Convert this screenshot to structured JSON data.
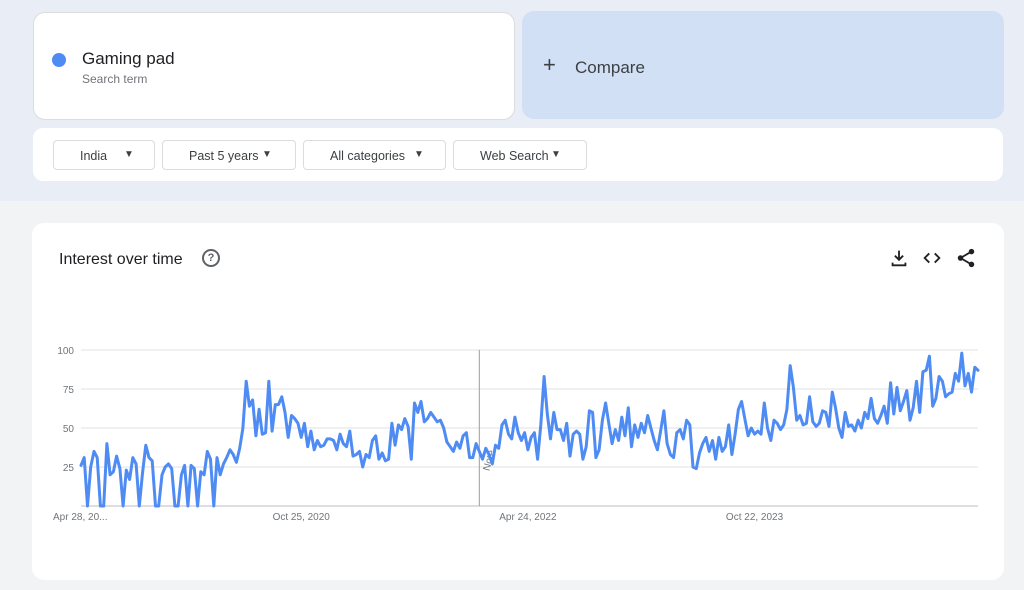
{
  "search_term": {
    "name": "Gaming pad",
    "subtitle": "Search term",
    "color": "#4e8cf4"
  },
  "compare": {
    "plus": "+",
    "label": "Compare"
  },
  "filters": {
    "region": "India",
    "time_range": "Past 5 years",
    "category": "All categories",
    "search_type": "Web Search"
  },
  "chart_section": {
    "title": "Interest over time",
    "help_icon": "help-circle-icon",
    "tools": [
      "download-icon",
      "embed-code-icon",
      "share-icon"
    ]
  },
  "chart_data": {
    "type": "line",
    "y_ticks": [
      25,
      50,
      75,
      100
    ],
    "ylim": [
      0,
      100
    ],
    "x_labels": [
      "Apr 28, 20...",
      "Oct 25, 2020",
      "Apr 24, 2022",
      "Oct 22, 2023"
    ],
    "grid": true,
    "annotation_week_index": 123,
    "annotation_label": "Note",
    "series": [
      {
        "color": "#4e8cf4",
        "values": [
          26,
          31,
          0,
          25,
          35,
          31,
          0,
          0,
          40,
          20,
          22,
          32,
          24,
          0,
          23,
          17,
          31,
          27,
          0,
          21,
          39,
          31,
          29,
          0,
          0,
          20,
          25,
          27,
          24,
          0,
          0,
          20,
          26,
          0,
          26,
          24,
          0,
          22,
          20,
          35,
          30,
          0,
          31,
          20,
          27,
          31,
          36,
          33,
          28,
          37,
          50,
          80,
          64,
          68,
          45,
          62,
          46,
          47,
          80,
          48,
          65,
          65,
          70,
          60,
          44,
          58,
          56,
          53,
          44,
          53,
          38,
          48,
          36,
          42,
          38,
          39,
          43,
          43,
          42,
          36,
          46,
          40,
          38,
          48,
          32,
          33,
          35,
          25,
          33,
          31,
          42,
          45,
          30,
          34,
          29,
          30,
          53,
          39,
          52,
          49,
          56,
          51,
          30,
          66,
          60,
          67,
          54,
          56,
          60,
          57,
          54,
          55,
          50,
          41,
          38,
          35,
          41,
          37,
          45,
          47,
          31,
          31,
          40,
          35,
          30,
          37,
          33,
          27,
          39,
          37,
          52,
          55,
          46,
          43,
          57,
          47,
          42,
          47,
          36,
          44,
          47,
          30,
          52,
          83,
          59,
          43,
          60,
          49,
          49,
          42,
          53,
          32,
          46,
          48,
          46,
          30,
          38,
          61,
          60,
          31,
          36,
          55,
          66,
          53,
          40,
          49,
          42,
          57,
          45,
          63,
          38,
          52,
          44,
          53,
          47,
          58,
          50,
          42,
          36,
          48,
          61,
          40,
          33,
          31,
          47,
          49,
          43,
          55,
          52,
          25,
          24,
          34,
          40,
          44,
          35,
          42,
          30,
          44,
          35,
          38,
          52,
          33,
          46,
          62,
          67,
          56,
          45,
          50,
          46,
          48,
          46,
          66,
          50,
          42,
          55,
          53,
          49,
          52,
          62,
          90,
          76,
          55,
          58,
          52,
          53,
          70,
          54,
          51,
          53,
          61,
          60,
          51,
          73,
          63,
          50,
          44,
          60,
          51,
          52,
          48,
          55,
          50,
          60,
          56,
          69,
          56,
          53,
          58,
          64,
          53,
          79,
          59,
          76,
          61,
          67,
          74,
          55,
          63,
          80,
          60,
          86,
          87,
          96,
          64,
          69,
          83,
          80,
          70,
          72,
          73,
          85,
          80,
          98,
          77,
          85,
          73,
          89,
          87
        ]
      }
    ]
  }
}
